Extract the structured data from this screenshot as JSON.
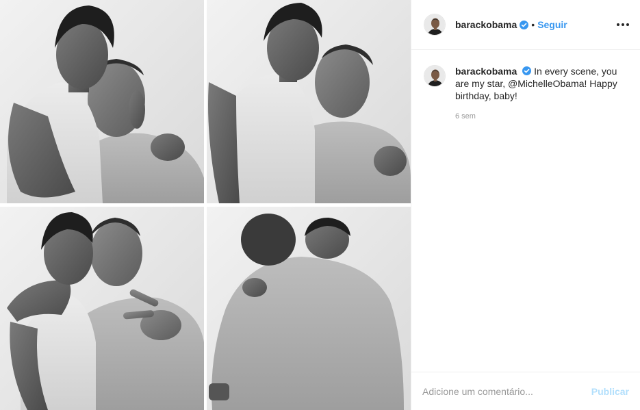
{
  "post": {
    "username": "barackobama",
    "verified": true,
    "separator": "•",
    "follow_label": "Seguir",
    "caption": {
      "username": "barackobama",
      "text": "In every scene, you are my star, @MichelleObama! Happy birthday, baby!",
      "timestamp": "6 sem"
    },
    "photo": {
      "description_icon": "photo-booth-strip-icon",
      "panels": 4
    }
  },
  "comment": {
    "placeholder": "Adicione um comentário...",
    "publish_label": "Publicar"
  },
  "colors": {
    "link": "#3897f0",
    "verified": "#3897f0",
    "publish_disabled": "#b2dffc",
    "border": "#efefef",
    "muted": "#999999"
  }
}
